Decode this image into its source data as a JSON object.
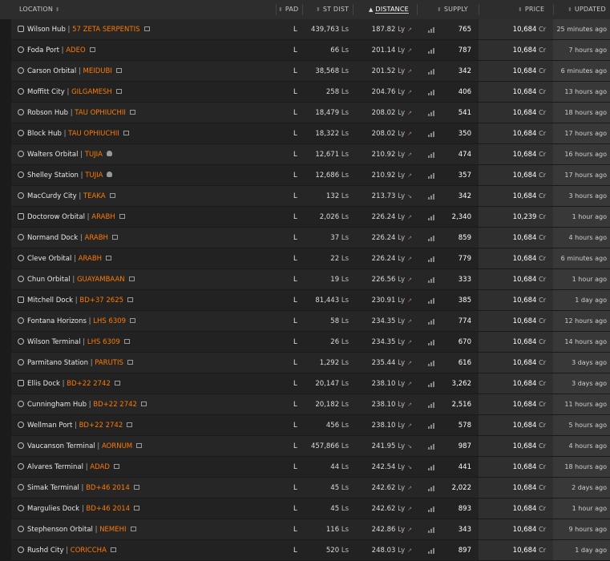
{
  "header": {
    "location": "LOCATION",
    "pad": "PAD",
    "st_dist": "ST DIST",
    "distance": "DISTANCE",
    "supply": "SUPPLY",
    "price": "PRICE",
    "updated": "UPDATED"
  },
  "rows": [
    {
      "station": "Wilson Hub",
      "system": "57 ZETA SERPENTIS",
      "pad": "L",
      "st_dist": "439,763",
      "distance": "187.82",
      "supply": "765",
      "price": "10,684",
      "updated": "25 minutes ago",
      "icon": "outpost",
      "extra": "copy",
      "trend": "up"
    },
    {
      "station": "Foda Port",
      "system": "ADEO",
      "pad": "L",
      "st_dist": "66",
      "distance": "201.14",
      "supply": "787",
      "price": "10,684",
      "updated": "7 hours ago",
      "icon": "orbital",
      "extra": "copy",
      "trend": "up"
    },
    {
      "station": "Carson Orbital",
      "system": "MEIDUBI",
      "pad": "L",
      "st_dist": "38,568",
      "distance": "201.52",
      "supply": "342",
      "price": "10,684",
      "updated": "6 minutes ago",
      "icon": "orbital",
      "extra": "copy",
      "trend": "up"
    },
    {
      "station": "Moffitt City",
      "system": "GILGAMESH",
      "pad": "L",
      "st_dist": "258",
      "distance": "204.76",
      "supply": "406",
      "price": "10,684",
      "updated": "13 hours ago",
      "icon": "orbital",
      "extra": "copy",
      "trend": "up"
    },
    {
      "station": "Robson Hub",
      "system": "TAU OPHIUCHII",
      "pad": "L",
      "st_dist": "18,479",
      "distance": "208.02",
      "supply": "541",
      "price": "10,684",
      "updated": "18 hours ago",
      "icon": "orbital",
      "extra": "copy",
      "trend": "up"
    },
    {
      "station": "Block Hub",
      "system": "TAU OPHIUCHII",
      "pad": "L",
      "st_dist": "18,322",
      "distance": "208.02",
      "supply": "350",
      "price": "10,684",
      "updated": "17 hours ago",
      "icon": "orbital",
      "extra": "copy",
      "trend": "up"
    },
    {
      "station": "Walters Orbital",
      "system": "TUJIA",
      "pad": "L",
      "st_dist": "12,671",
      "distance": "210.92",
      "supply": "474",
      "price": "10,684",
      "updated": "16 hours ago",
      "icon": "orbital",
      "extra": "skull",
      "trend": "up"
    },
    {
      "station": "Shelley Station",
      "system": "TUJIA",
      "pad": "L",
      "st_dist": "12,686",
      "distance": "210.92",
      "supply": "357",
      "price": "10,684",
      "updated": "17 hours ago",
      "icon": "orbital",
      "extra": "skull",
      "trend": "up"
    },
    {
      "station": "MacCurdy City",
      "system": "TEAKA",
      "pad": "L",
      "st_dist": "132",
      "distance": "213.73",
      "supply": "342",
      "price": "10,684",
      "updated": "3 hours ago",
      "icon": "orbital",
      "extra": "copy",
      "trend": "down"
    },
    {
      "station": "Doctorow Orbital",
      "system": "ARABH",
      "pad": "L",
      "st_dist": "2,026",
      "distance": "226.24",
      "supply": "2,340",
      "price": "10,239",
      "updated": "1 hour ago",
      "icon": "outpost",
      "extra": "copy",
      "trend": "up"
    },
    {
      "station": "Normand Dock",
      "system": "ARABH",
      "pad": "L",
      "st_dist": "37",
      "distance": "226.24",
      "supply": "859",
      "price": "10,684",
      "updated": "4 hours ago",
      "icon": "orbital",
      "extra": "copy",
      "trend": "up"
    },
    {
      "station": "Cleve Orbital",
      "system": "ARABH",
      "pad": "L",
      "st_dist": "22",
      "distance": "226.24",
      "supply": "779",
      "price": "10,684",
      "updated": "6 minutes ago",
      "icon": "orbital",
      "extra": "copy",
      "trend": "up"
    },
    {
      "station": "Chun Orbital",
      "system": "GUAYAMBAAN",
      "pad": "L",
      "st_dist": "19",
      "distance": "226.56",
      "supply": "333",
      "price": "10,684",
      "updated": "1 hour ago",
      "icon": "orbital",
      "extra": "copy",
      "trend": "up"
    },
    {
      "station": "Mitchell Dock",
      "system": "BD+37 2625",
      "pad": "L",
      "st_dist": "81,443",
      "distance": "230.91",
      "supply": "385",
      "price": "10,684",
      "updated": "1 day ago",
      "icon": "outpost",
      "extra": "copy",
      "trend": "up"
    },
    {
      "station": "Fontana Horizons",
      "system": "LHS 6309",
      "pad": "L",
      "st_dist": "58",
      "distance": "234.35",
      "supply": "774",
      "price": "10,684",
      "updated": "12 hours ago",
      "icon": "orbital",
      "extra": "copy",
      "trend": "up"
    },
    {
      "station": "Wilson Terminal",
      "system": "LHS 6309",
      "pad": "L",
      "st_dist": "26",
      "distance": "234.35",
      "supply": "670",
      "price": "10,684",
      "updated": "14 hours ago",
      "icon": "orbital",
      "extra": "copy",
      "trend": "up"
    },
    {
      "station": "Parmitano Station",
      "system": "PARUTIS",
      "pad": "L",
      "st_dist": "1,292",
      "distance": "235.44",
      "supply": "616",
      "price": "10,684",
      "updated": "3 days ago",
      "icon": "orbital",
      "extra": "copy",
      "trend": "up"
    },
    {
      "station": "Ellis Dock",
      "system": "BD+22 2742",
      "pad": "L",
      "st_dist": "20,147",
      "distance": "238.10",
      "supply": "3,262",
      "price": "10,684",
      "updated": "3 days ago",
      "icon": "outpost",
      "extra": "copy",
      "trend": "up"
    },
    {
      "station": "Cunningham Hub",
      "system": "BD+22 2742",
      "pad": "L",
      "st_dist": "20,182",
      "distance": "238.10",
      "supply": "2,516",
      "price": "10,684",
      "updated": "11 hours ago",
      "icon": "orbital",
      "extra": "copy",
      "trend": "up"
    },
    {
      "station": "Wellman Port",
      "system": "BD+22 2742",
      "pad": "L",
      "st_dist": "456",
      "distance": "238.10",
      "supply": "578",
      "price": "10,684",
      "updated": "5 hours ago",
      "icon": "orbital",
      "extra": "copy",
      "trend": "up"
    },
    {
      "station": "Vaucanson Terminal",
      "system": "AORNUM",
      "pad": "L",
      "st_dist": "457,866",
      "distance": "241.95",
      "supply": "987",
      "price": "10,684",
      "updated": "4 hours ago",
      "icon": "orbital",
      "extra": "copy",
      "trend": "down"
    },
    {
      "station": "Alvares Terminal",
      "system": "ADAD",
      "pad": "L",
      "st_dist": "44",
      "distance": "242.54",
      "supply": "441",
      "price": "10,684",
      "updated": "18 hours ago",
      "icon": "orbital",
      "extra": "copy",
      "trend": "down"
    },
    {
      "station": "Simak Terminal",
      "system": "BD+46 2014",
      "pad": "L",
      "st_dist": "45",
      "distance": "242.62",
      "supply": "2,022",
      "price": "10,684",
      "updated": "2 days ago",
      "icon": "orbital",
      "extra": "copy",
      "trend": "up"
    },
    {
      "station": "Margulies Dock",
      "system": "BD+46 2014",
      "pad": "L",
      "st_dist": "45",
      "distance": "242.62",
      "supply": "893",
      "price": "10,684",
      "updated": "1 hour ago",
      "icon": "orbital",
      "extra": "copy",
      "trend": "up"
    },
    {
      "station": "Stephenson Orbital",
      "system": "NEMEHI",
      "pad": "L",
      "st_dist": "116",
      "distance": "242.86",
      "supply": "343",
      "price": "10,684",
      "updated": "9 hours ago",
      "icon": "orbital",
      "extra": "copy",
      "trend": "up"
    },
    {
      "station": "Rushd City",
      "system": "CORICCHA",
      "pad": "L",
      "st_dist": "520",
      "distance": "248.03",
      "supply": "897",
      "price": "10,684",
      "updated": "1 day ago",
      "icon": "orbital",
      "extra": "copy",
      "trend": "up"
    }
  ],
  "units": {
    "ls": "Ls",
    "ly": "Ly",
    "cr": "Cr",
    "pipe": "|"
  },
  "colors": {
    "system": "#ff7a00",
    "background": "#1d1d1d",
    "header": "#2d2d2d"
  }
}
